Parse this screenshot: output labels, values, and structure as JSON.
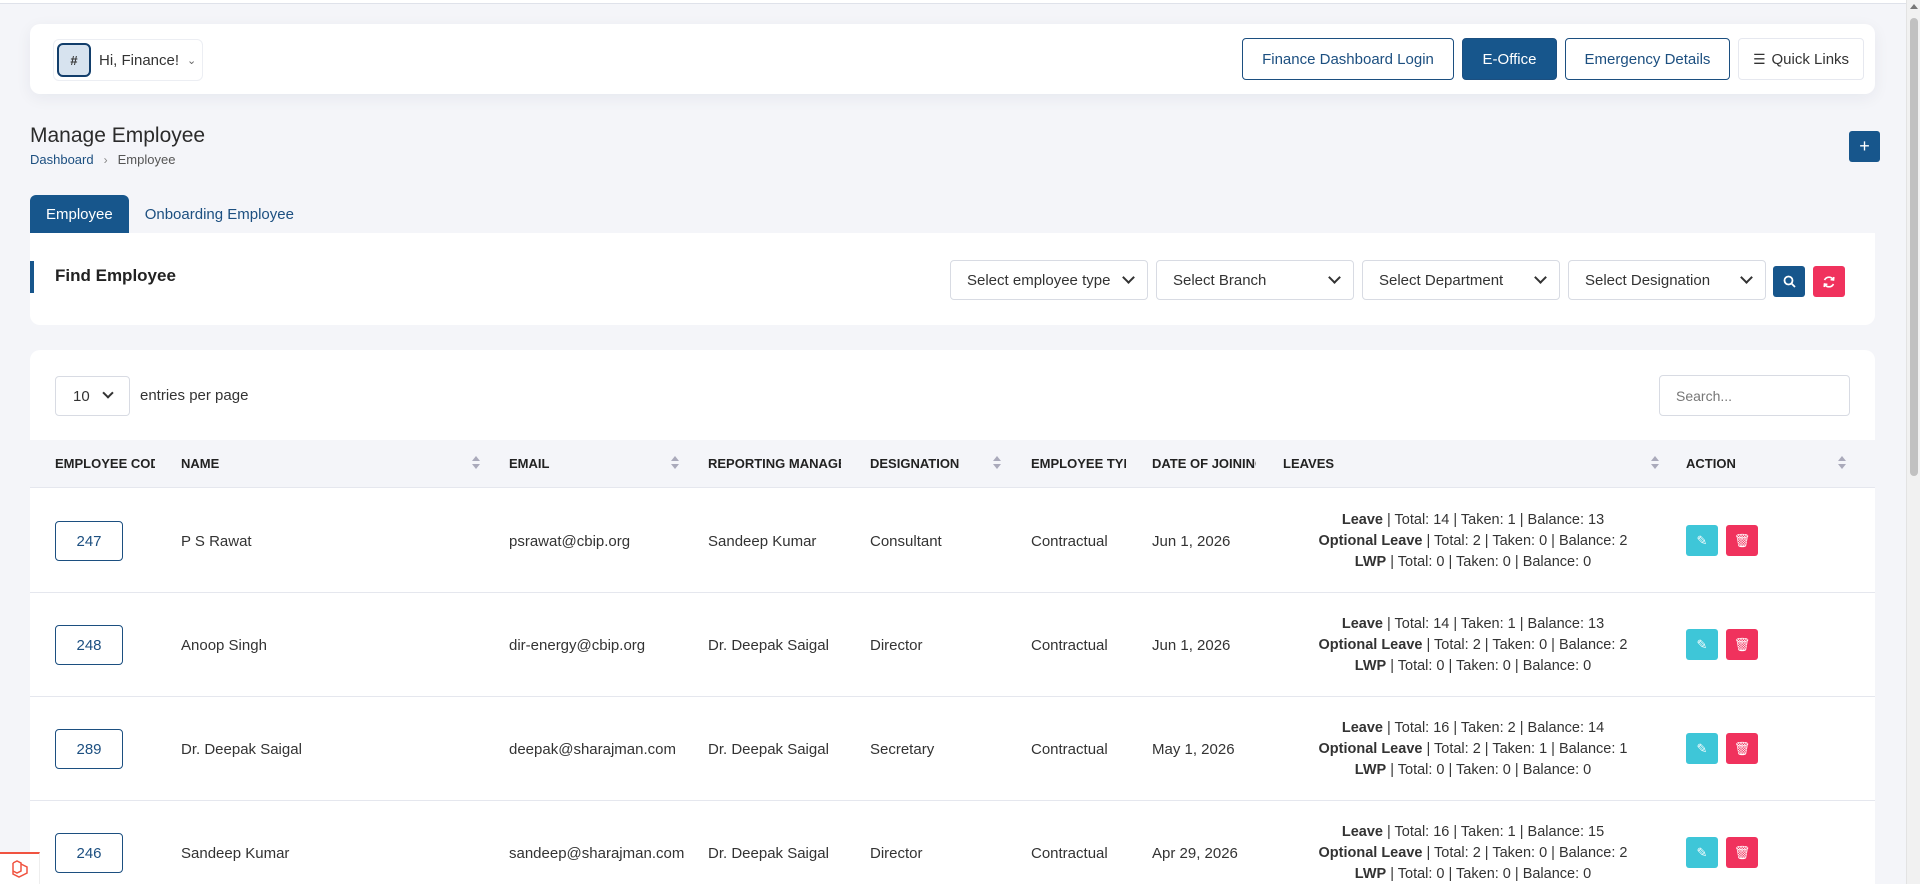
{
  "navbar": {
    "avatar_alt": "#",
    "greeting": "Hi, Finance!",
    "buttons": {
      "finance_dashboard": "Finance Dashboard Login",
      "eoffice": "E-Office",
      "emergency": "Emergency Details",
      "quick_links": "Quick Links"
    }
  },
  "page": {
    "title": "Manage Employee",
    "breadcrumb": {
      "home": "Dashboard",
      "current": "Employee"
    },
    "add_label": "+"
  },
  "tabs": {
    "employee": "Employee",
    "onboarding": "Onboarding Employee"
  },
  "filters": {
    "title": "Find Employee",
    "employee_type": "Select employee type",
    "branch": "Select Branch",
    "department": "Select Department",
    "designation": "Select Designation"
  },
  "table": {
    "entries_value": "10",
    "entries_label": "entries per page",
    "search_placeholder": "Search...",
    "headers": {
      "code": "Employee Code",
      "name": "Name",
      "email": "Email",
      "manager": "Reporting Manager",
      "designation": "Designation",
      "type": "Employee Type",
      "doj": "Date of Joining",
      "leaves": "Leaves",
      "action": "Action"
    },
    "rows": [
      {
        "code": "247",
        "name": "P S Rawat",
        "email": "psrawat@cbip.org",
        "manager": "Sandeep Kumar",
        "designation": "Consultant",
        "type": "Contractual",
        "doj": "Jun 1, 2026",
        "leave_label": "Leave",
        "leave_text": " | Total: 14 | Taken: 1 | Balance: 13",
        "optional_label": "Optional Leave",
        "optional_text": " | Total: 2 | Taken: 0 | Balance: 2",
        "lwp_label": "LWP",
        "lwp_text": " | Total: 0 | Taken: 0 | Balance: 0"
      },
      {
        "code": "248",
        "name": "Anoop Singh",
        "email": "dir-energy@cbip.org",
        "manager": "Dr. Deepak Saigal",
        "designation": "Director",
        "type": "Contractual",
        "doj": "Jun 1, 2026",
        "leave_label": "Leave",
        "leave_text": " | Total: 14 | Taken: 1 | Balance: 13",
        "optional_label": "Optional Leave",
        "optional_text": " | Total: 2 | Taken: 0 | Balance: 2",
        "lwp_label": "LWP",
        "lwp_text": " | Total: 0 | Taken: 0 | Balance: 0"
      },
      {
        "code": "289",
        "name": "Dr. Deepak Saigal",
        "email": "deepak@sharajman.com",
        "manager": "Dr. Deepak Saigal",
        "designation": "Secretary",
        "type": "Contractual",
        "doj": "May 1, 2026",
        "leave_label": "Leave",
        "leave_text": " | Total: 16 | Taken: 2 | Balance: 14",
        "optional_label": "Optional Leave",
        "optional_text": " | Total: 2 | Taken: 1 | Balance: 1",
        "lwp_label": "LWP",
        "lwp_text": " | Total: 0 | Taken: 0 | Balance: 0"
      },
      {
        "code": "246",
        "name": "Sandeep Kumar",
        "email": "sandeep@sharajman.com",
        "manager": "Dr. Deepak Saigal",
        "designation": "Director",
        "type": "Contractual",
        "doj": "Apr 29, 2026",
        "leave_label": "Leave",
        "leave_text": " | Total: 16 | Taken: 1 | Balance: 15",
        "optional_label": "Optional Leave",
        "optional_text": " | Total: 2 | Taken: 0 | Balance: 2",
        "lwp_label": "LWP",
        "lwp_text": " | Total: 0 | Taken: 0 | Balance: 0"
      }
    ]
  },
  "colors": {
    "primary": "#17568c",
    "danger": "#f0325d",
    "info": "#3ec6d8"
  }
}
